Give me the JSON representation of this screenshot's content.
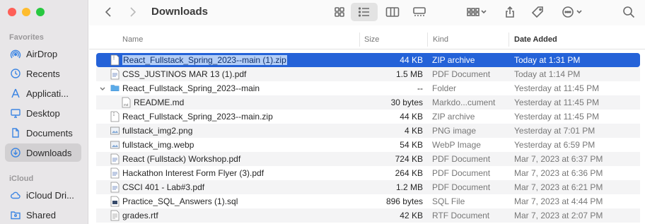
{
  "toolbar": {
    "title": "Downloads"
  },
  "sidebar": {
    "favorites_label": "Favorites",
    "icloud_label": "iCloud",
    "favorites": [
      {
        "label": "AirDrop",
        "icon": "airdrop-icon"
      },
      {
        "label": "Recents",
        "icon": "clock-icon"
      },
      {
        "label": "Applicati...",
        "icon": "applications-icon"
      },
      {
        "label": "Desktop",
        "icon": "desktop-icon"
      },
      {
        "label": "Documents",
        "icon": "document-icon"
      },
      {
        "label": "Downloads",
        "icon": "download-icon",
        "active": true
      }
    ],
    "icloud": [
      {
        "label": "iCloud Dri...",
        "icon": "cloud-icon"
      },
      {
        "label": "Shared",
        "icon": "shared-folder-icon"
      }
    ]
  },
  "columns": {
    "name": "Name",
    "size": "Size",
    "kind": "Kind",
    "date": "Date Added"
  },
  "files": [
    {
      "name": "React_Fullstack_Spring_2023--main (1).zip",
      "size": "44 KB",
      "kind": "ZIP archive",
      "date": "Today at 1:31 PM",
      "icon": "zip-icon",
      "selected": true
    },
    {
      "name": "CSS_JUSTINOS MAR 13 (1).pdf",
      "size": "1.5 MB",
      "kind": "PDF Document",
      "date": "Today at 1:14 PM",
      "icon": "pdf-icon"
    },
    {
      "name": "React_Fullstack_Spring_2023--main",
      "size": "--",
      "kind": "Folder",
      "date": "Yesterday at 11:45 PM",
      "icon": "folder-icon",
      "expanded": true
    },
    {
      "name": "README.md",
      "size": "30 bytes",
      "kind": "Markdo...cument",
      "date": "Yesterday at 11:45 PM",
      "icon": "markdown-icon",
      "child": true
    },
    {
      "name": "React_Fullstack_Spring_2023--main.zip",
      "size": "44 KB",
      "kind": "ZIP archive",
      "date": "Yesterday at 11:45 PM",
      "icon": "zip-icon"
    },
    {
      "name": "fullstack_img2.png",
      "size": "4 KB",
      "kind": "PNG image",
      "date": "Yesterday at 7:01 PM",
      "icon": "image-icon"
    },
    {
      "name": "fullstack_img.webp",
      "size": "54 KB",
      "kind": "WebP Image",
      "date": "Yesterday at 6:59 PM",
      "icon": "image-icon"
    },
    {
      "name": "React (Fullstack) Workshop.pdf",
      "size": "724 KB",
      "kind": "PDF Document",
      "date": "Mar 7, 2023 at 6:37 PM",
      "icon": "pdf-icon"
    },
    {
      "name": "Hackathon Interest Form Flyer (3).pdf",
      "size": "264 KB",
      "kind": "PDF Document",
      "date": "Mar 7, 2023 at 6:36 PM",
      "icon": "pdf-icon"
    },
    {
      "name": "CSCI 401 - Lab#3.pdf",
      "size": "1.2 MB",
      "kind": "PDF Document",
      "date": "Mar 7, 2023 at 6:21 PM",
      "icon": "pdf-icon"
    },
    {
      "name": "Practice_SQL_Answers (1).sql",
      "size": "896 bytes",
      "kind": "SQL File",
      "date": "Mar 7, 2023 at 4:44 PM",
      "icon": "sql-icon"
    },
    {
      "name": "grades.rtf",
      "size": "42 KB",
      "kind": "RTF Document",
      "date": "Mar 7, 2023 at 2:07 PM",
      "icon": "rtf-icon"
    }
  ],
  "colors": {
    "selection": "#2462d8",
    "accent": "#1a73e8",
    "folder": "#5aaae8"
  }
}
